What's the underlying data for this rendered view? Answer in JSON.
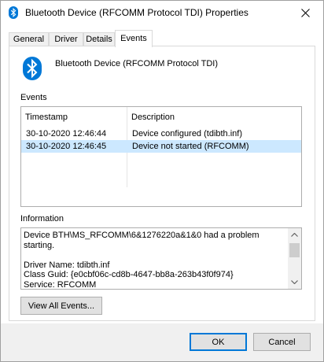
{
  "window": {
    "title": "Bluetooth Device (RFCOMM Protocol TDI) Properties",
    "close_glyph": "✕"
  },
  "tabs": [
    {
      "label": "General",
      "active": false
    },
    {
      "label": "Driver",
      "active": false
    },
    {
      "label": "Details",
      "active": false
    },
    {
      "label": "Events",
      "active": true
    }
  ],
  "device": {
    "name": "Bluetooth Device (RFCOMM Protocol TDI)",
    "icon": "bluetooth-icon",
    "icon_color": "#0078d7"
  },
  "events": {
    "label": "Events",
    "columns": [
      "Timestamp",
      "Description"
    ],
    "rows": [
      {
        "timestamp": "30-10-2020 12:46:44",
        "description": "Device configured (tdibth.inf)",
        "selected": false
      },
      {
        "timestamp": "30-10-2020 12:46:45",
        "description": "Device not started (RFCOMM)",
        "selected": true
      }
    ]
  },
  "information": {
    "label": "Information",
    "text": "Device BTH\\MS_RFCOMM\\6&1276220a&1&0 had a problem starting.\n\nDriver Name: tdibth.inf\nClass Guid: {e0cbf06c-cd8b-4647-bb8a-263b43f0f974}\nService: RFCOMM"
  },
  "buttons": {
    "view_all_events": "View All Events...",
    "ok": "OK",
    "cancel": "Cancel"
  },
  "colors": {
    "selection": "#cce8ff",
    "accent": "#0078d7"
  }
}
